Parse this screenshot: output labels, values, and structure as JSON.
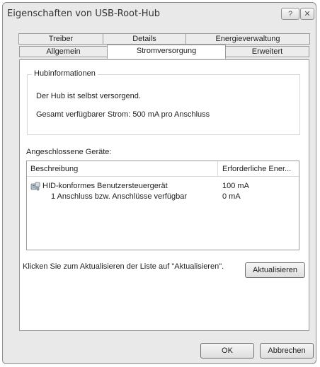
{
  "window": {
    "title": "Eigenschaften von USB-Root-Hub",
    "help_label": "?",
    "close_label": "✕"
  },
  "tabs": {
    "row_back": [
      "Treiber",
      "Details",
      "Energieverwaltung"
    ],
    "row_front": [
      "Allgemein",
      "Stromversorgung",
      "Erweitert"
    ],
    "active": "Stromversorgung"
  },
  "hubinfo": {
    "title": "Hubinformationen",
    "line1": "Der Hub ist selbst versorgend.",
    "line2": "Gesamt verfügbarer Strom: 500 mA pro Anschluss"
  },
  "devices": {
    "label": "Angeschlossene Geräte:",
    "columns": [
      "Beschreibung",
      "Erforderliche Ener..."
    ],
    "rows": [
      {
        "icon": "hid-device-icon",
        "description": "HID-konformes Benutzersteuergerät",
        "power": "100 mA"
      },
      {
        "icon": "",
        "description": "1 Anschluss bzw. Anschlüsse verfügbar",
        "power": "0 mA"
      }
    ]
  },
  "refresh": {
    "hint": "Klicken Sie zum Aktualisieren der Liste auf \"Aktualisieren\".",
    "button": "Aktualisieren"
  },
  "footer": {
    "ok": "OK",
    "cancel": "Abbrechen"
  }
}
